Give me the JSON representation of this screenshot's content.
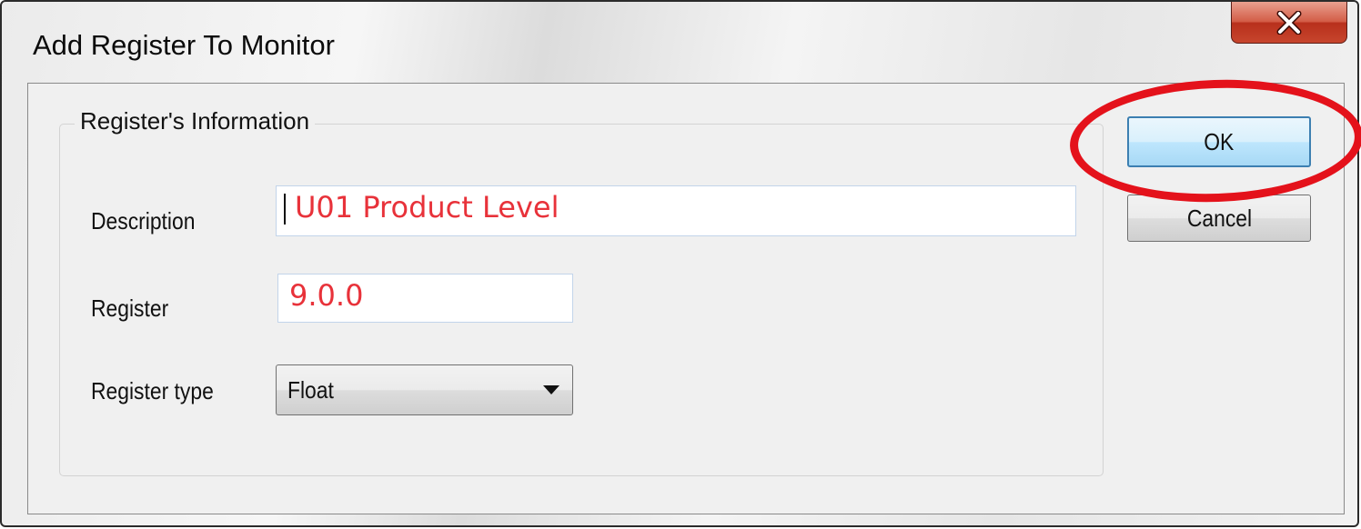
{
  "window": {
    "title": "Add Register To Monitor",
    "close_icon": "close-x-icon"
  },
  "group": {
    "legend": "Register's Information"
  },
  "fields": {
    "description_label": "Description",
    "description_value": "U01 Product Level",
    "register_label": "Register",
    "register_value": "9.0.0",
    "register_type_label": "Register type",
    "register_type_value": "Float"
  },
  "buttons": {
    "ok_label": "OK",
    "cancel_label": "Cancel"
  },
  "colors": {
    "field_text": "#e8323a",
    "highlight_ring": "#e4121b",
    "close_button": "#c7452d",
    "ok_border": "#3c7fb1"
  }
}
